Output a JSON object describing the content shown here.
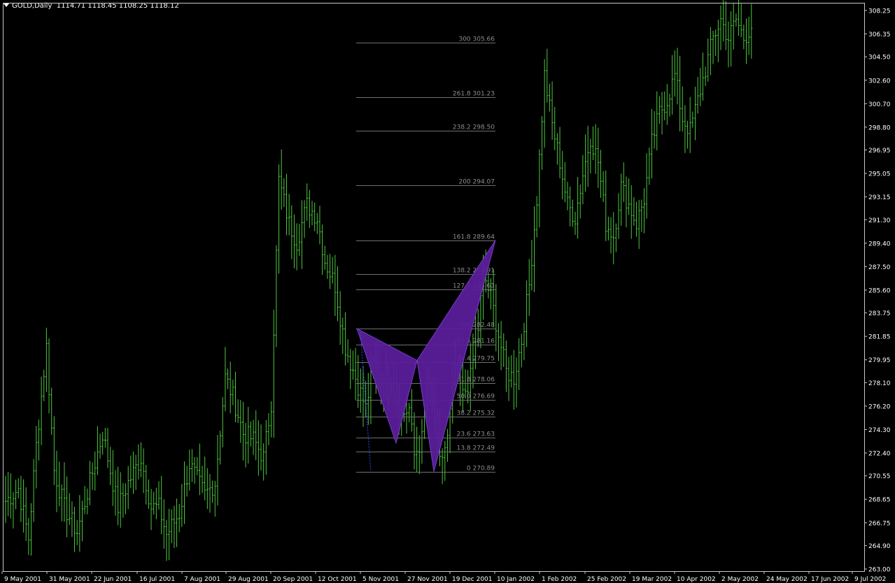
{
  "header": {
    "symbol": "GOLD,Daily",
    "ohlc": "1114.71 1118.45 1108.25 1118.12"
  },
  "colors": {
    "background": "#000000",
    "bars": "#4cc83c",
    "frame": "#c8c8c8",
    "axis_text": "#ffffff",
    "fib_line": "#707070",
    "fib_text": "#8c8c8c",
    "pattern_fill": "#5a1e9a",
    "pattern_edge": "#7b3fd0",
    "dotted": "#3050ff"
  },
  "chart_data": {
    "type": "ohlc",
    "grid": false,
    "ylim": [
      263.0,
      309.5
    ],
    "yticks": [
      "308.25",
      "306.35",
      "304.50",
      "302.60",
      "300.70",
      "298.80",
      "296.95",
      "295.05",
      "293.15",
      "291.30",
      "289.40",
      "287.50",
      "285.60",
      "283.75",
      "281.85",
      "279.95",
      "278.10",
      "276.20",
      "274.30",
      "272.40",
      "270.55",
      "268.65",
      "266.75",
      "264.90",
      "263.00"
    ],
    "xticks": [
      "9 May 2001",
      "31 May 2001",
      "22 Jun 2001",
      "16 Jul 2001",
      "7 Aug 2001",
      "29 Aug 2001",
      "20 Sep 2001",
      "12 Oct 2001",
      "5 Nov 2001",
      "27 Nov 2001",
      "19 Dec 2001",
      "10 Jan 2002",
      "1 Feb 2002",
      "25 Feb 2002",
      "19 Mar 2002",
      "10 Apr 2002",
      "2 May 2002",
      "24 May 2002",
      "17 Jun 2002",
      "9 Jul 2002"
    ],
    "series_anchors": [
      [
        0,
        268.5
      ],
      [
        5,
        269.5
      ],
      [
        9,
        265.5
      ],
      [
        12,
        273
      ],
      [
        16,
        281
      ],
      [
        19,
        271
      ],
      [
        23,
        268
      ],
      [
        28,
        266
      ],
      [
        33,
        270
      ],
      [
        38,
        274
      ],
      [
        44,
        268
      ],
      [
        48,
        270
      ],
      [
        53,
        272
      ],
      [
        57,
        268
      ],
      [
        60,
        268
      ],
      [
        63,
        265.8
      ],
      [
        68,
        267.5
      ],
      [
        72,
        271.5
      ],
      [
        78,
        269
      ],
      [
        82,
        270
      ],
      [
        86,
        278.5
      ],
      [
        89,
        277
      ],
      [
        93,
        274
      ],
      [
        97,
        273.5
      ],
      [
        101,
        272
      ],
      [
        104,
        276.5
      ],
      [
        107,
        294.5
      ],
      [
        111,
        291
      ],
      [
        114,
        289.5
      ],
      [
        118,
        292.5
      ],
      [
        122,
        291.5
      ],
      [
        125,
        288
      ],
      [
        129,
        286
      ],
      [
        133,
        281
      ],
      [
        137,
        278.5
      ],
      [
        141,
        276
      ],
      [
        144,
        279.5
      ],
      [
        148,
        278
      ],
      [
        151,
        278.5
      ],
      [
        155,
        275.5
      ],
      [
        158,
        276
      ],
      [
        160,
        272.2
      ],
      [
        163,
        273.5
      ],
      [
        165,
        278.5
      ],
      [
        168,
        275
      ],
      [
        170,
        271.5
      ],
      [
        173,
        273.5
      ],
      [
        176,
        279.5
      ],
      [
        179,
        277
      ],
      [
        182,
        278.5
      ],
      [
        185,
        282.5
      ],
      [
        187,
        287
      ],
      [
        190,
        285
      ],
      [
        193,
        282
      ],
      [
        196,
        279
      ],
      [
        199,
        278.5
      ],
      [
        202,
        281.5
      ],
      [
        205,
        286
      ],
      [
        208,
        293
      ],
      [
        211,
        303
      ],
      [
        214,
        299
      ],
      [
        217,
        296
      ],
      [
        220,
        292.5
      ],
      [
        223,
        291.5
      ],
      [
        226,
        295
      ],
      [
        229,
        298
      ],
      [
        232,
        296
      ],
      [
        235,
        291
      ],
      [
        238,
        290
      ],
      [
        241,
        294
      ],
      [
        244,
        292.5
      ],
      [
        247,
        291
      ],
      [
        250,
        293
      ],
      [
        253,
        297.5
      ],
      [
        256,
        300
      ],
      [
        259,
        301
      ],
      [
        262,
        303
      ],
      [
        265,
        299.5
      ],
      [
        268,
        298.5
      ],
      [
        271,
        301
      ],
      [
        274,
        303.5
      ],
      [
        277,
        306
      ],
      [
        280,
        307.5
      ],
      [
        283,
        306
      ],
      [
        286,
        307.5
      ],
      [
        289,
        306
      ],
      [
        292,
        307
      ]
    ],
    "fibonacci": [
      {
        "level": "300",
        "price": "305.66"
      },
      {
        "level": "261.8",
        "price": "301.23"
      },
      {
        "level": "238.2",
        "price": "298.50"
      },
      {
        "level": "200",
        "price": "294.07"
      },
      {
        "level": "161.8",
        "price": "289.64"
      },
      {
        "level": "138.2",
        "price": "286.91"
      },
      {
        "level": "127.2",
        "price": "285.63"
      },
      {
        "level": "100",
        "price": "282.48"
      },
      {
        "level": "88.6",
        "price": "281.16"
      },
      {
        "level": "76.4",
        "price": "279.75"
      },
      {
        "level": "61.8",
        "price": "278.06"
      },
      {
        "level": "50.0",
        "price": "276.69"
      },
      {
        "level": "38.2",
        "price": "275.32"
      },
      {
        "level": "23.6",
        "price": "273.63"
      },
      {
        "level": "13.8",
        "price": "272.49"
      },
      {
        "level": "0",
        "price": "270.89"
      }
    ],
    "pattern": {
      "X": 282.48,
      "A": 273.2,
      "B": 279.9,
      "C": 270.89,
      "D": 289.64
    }
  }
}
